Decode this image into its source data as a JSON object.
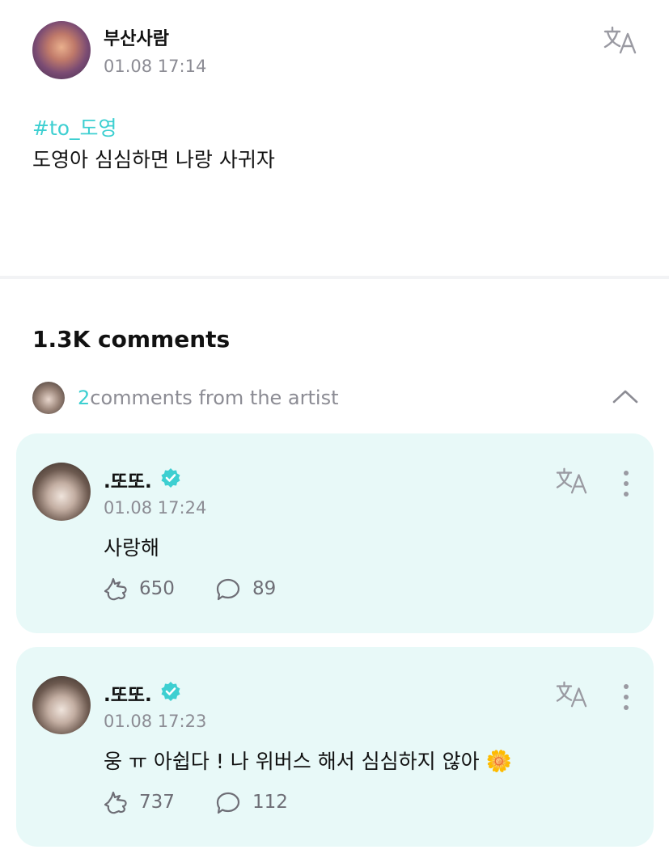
{
  "post": {
    "author": "부산사람",
    "time": "01.08 17:14",
    "tag": "#to_도영",
    "body": "도영아 심심하면 나랑 사귀자"
  },
  "comments_section": {
    "count_label": "1.3K comments",
    "artist_count": "2",
    "artist_label": "comments from the artist"
  },
  "comments": [
    {
      "author": ".또또.",
      "time": "01.08 17:24",
      "text": "사랑해",
      "likes": "650",
      "replies": "89"
    },
    {
      "author": ".또또.",
      "time": "01.08 17:23",
      "text": "웅 ㅠ 아쉽다 ! 나 위버스 해서 심심하지 않아",
      "emoji": "🌼",
      "likes": "737",
      "replies": "112"
    }
  ],
  "icons": {
    "translate": "translate-icon",
    "verified": "verified-badge-icon",
    "chevron": "chevron-up-icon",
    "more": "more-vertical-icon",
    "like": "like-icon",
    "reply": "reply-icon"
  },
  "colors": {
    "accent": "#3dcfd1",
    "card_bg": "#e8f9f8",
    "muted_text": "#8c8c94"
  }
}
